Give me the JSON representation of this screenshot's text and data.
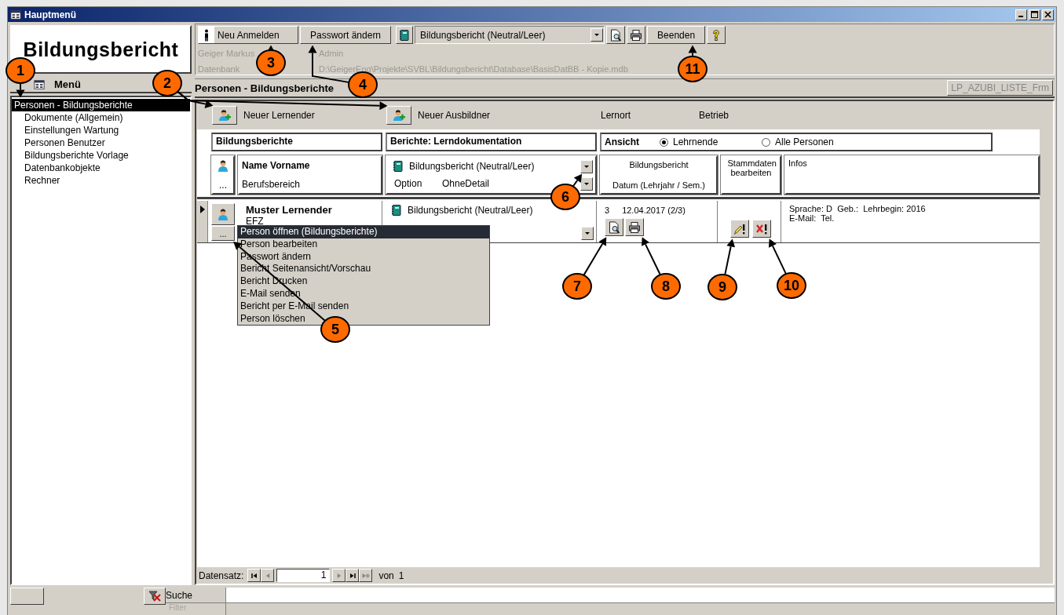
{
  "window": {
    "title": "Hauptmenü"
  },
  "header": {
    "logo": "Bildungsbericht",
    "toolbar": [
      {
        "kind": "userbutton",
        "label": "Neu Anmelden"
      },
      {
        "kind": "button",
        "label": "Passwort ändern"
      },
      {
        "kind": "combo",
        "value": "Bildungsbericht (Neutral/Leer)"
      },
      {
        "kind": "preview"
      },
      {
        "kind": "print"
      },
      {
        "kind": "button",
        "label": "Beenden"
      },
      {
        "kind": "help"
      }
    ],
    "user": "Geiger Markus",
    "role": "Admin",
    "db_label": "Datenbank",
    "db_path": "D:\\GeigerEng\\Projekte\\SVBL\\Bildungsbericht\\Database\\BasisDatBB - Kopie.mdb"
  },
  "menu": {
    "title": "Menü",
    "items": [
      {
        "label": "Personen - Bildungsberichte",
        "selected": true
      },
      {
        "label": "Dokumente (Allgemein)",
        "selected": false
      },
      {
        "label": "Einstellungen Wartung",
        "selected": false
      },
      {
        "label": "Personen Benutzer",
        "selected": false
      },
      {
        "label": "Bildungsberichte Vorlage",
        "selected": false
      },
      {
        "label": "Datenbankobjekte",
        "selected": false
      },
      {
        "label": "Rechner",
        "selected": false
      }
    ]
  },
  "form": {
    "title": "Personen - Bildungsberichte",
    "form_name": "LP_AZUBI_LISTE_Frm",
    "actions": [
      {
        "label": "Neuer Lernender"
      },
      {
        "label": "Neuer Ausbildner"
      }
    ],
    "lernort": "Lernort",
    "betrieb": "Betrieb",
    "group_headers": [
      "Bildungsberichte",
      "Berichte: Lerndokumentation"
    ],
    "view": {
      "label": "Ansicht",
      "options": [
        {
          "label": "Lehrnende",
          "selected": true
        },
        {
          "label": "Alle Personen",
          "selected": false
        }
      ]
    },
    "list_header": {
      "more": "...",
      "name": "Name Vorname",
      "field": "Berufsbereich",
      "report": "Bildungsbericht (Neutral/Leer)",
      "option_label": "Option",
      "option_value": "OhneDetail",
      "report_title": "Bildungsbericht",
      "date": "Datum (Lehrjahr / Sem.)",
      "master_data": "Stammdaten bearbeiten",
      "info": "Infos"
    },
    "rows": [
      {
        "current": true,
        "name": "Muster Lernender",
        "field": "EFZ",
        "more": "...",
        "report": "Bildungsbericht (Neutral/Leer)",
        "count": "3",
        "date": "12.04.2017 (2/3)",
        "info": [
          "Sprache: D  Geb.:  Lehrbegin: 2016",
          "E-Mail:  Tel."
        ]
      }
    ],
    "context_menu": [
      {
        "label": "Person öffnen (Bildungsberichte)",
        "selected": true
      },
      {
        "label": "Person bearbeiten",
        "selected": false
      },
      {
        "label": "Passwort ändern",
        "selected": false
      },
      {
        "label": "Bericht Seitenansicht/Vorschau",
        "selected": false
      },
      {
        "label": "Bericht Drucken",
        "selected": false
      },
      {
        "label": "E-Mail senden",
        "selected": false
      },
      {
        "label": "Bericht per E-Mail senden",
        "selected": false
      },
      {
        "label": "Person löschen",
        "selected": false
      }
    ],
    "navigation": {
      "label": "Datensatz:",
      "value": "1",
      "of": "von",
      "total": "1",
      "buttons": [
        {
          "disabled": false
        },
        {
          "disabled": true
        },
        {
          "disabled": true
        },
        {
          "disabled": false
        },
        {
          "disabled": true
        }
      ]
    }
  },
  "search": {
    "label": "Suche",
    "filter_label": "Filter"
  },
  "callouts": [
    "1",
    "2",
    "3",
    "4",
    "5",
    "6",
    "7",
    "8",
    "9",
    "10",
    "11"
  ]
}
